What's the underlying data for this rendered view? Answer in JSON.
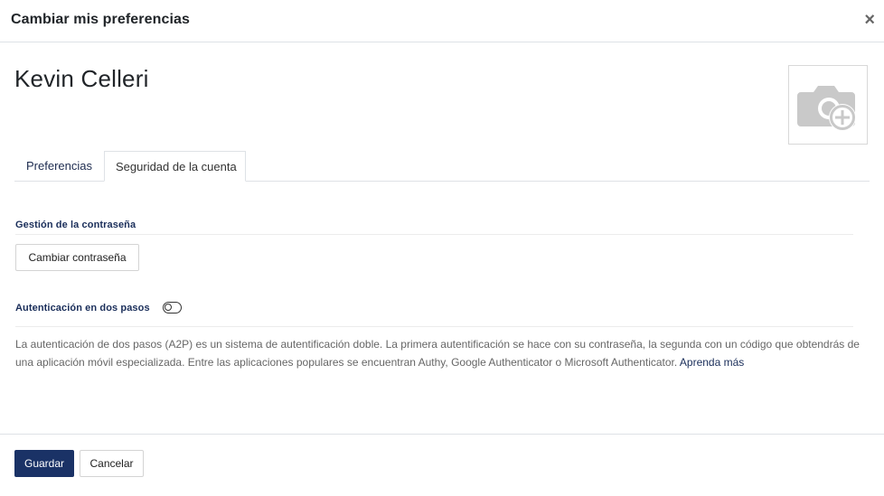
{
  "modal": {
    "title": "Cambiar mis preferencias",
    "close_symbol": "×"
  },
  "user": {
    "name": "Kevin Celleri",
    "avatar_icon": "camera-add-icon"
  },
  "tabs": [
    {
      "label": "Preferencias",
      "active": false
    },
    {
      "label": "Seguridad de la cuenta",
      "active": true
    }
  ],
  "password_section": {
    "title": "Gestión de la contraseña",
    "change_button": "Cambiar contraseña"
  },
  "two_factor": {
    "title": "Autenticación en dos pasos",
    "enabled": false,
    "description": "La autenticación de dos pasos (A2P) es un sistema de autentificación doble. La primera autentificación se hace con su contraseña, la segunda con un código que obtendrás de una aplicación móvil especializada. Entre las aplicaciones populares se encuentran Authy, Google Authenticator o Microsoft Authenticator.",
    "learn_more": "Aprenda más"
  },
  "footer": {
    "save_label": "Guardar",
    "cancel_label": "Cancelar"
  },
  "colors": {
    "primary": "#1a3266",
    "link": "#1a2e5a",
    "muted_text": "#666666"
  }
}
